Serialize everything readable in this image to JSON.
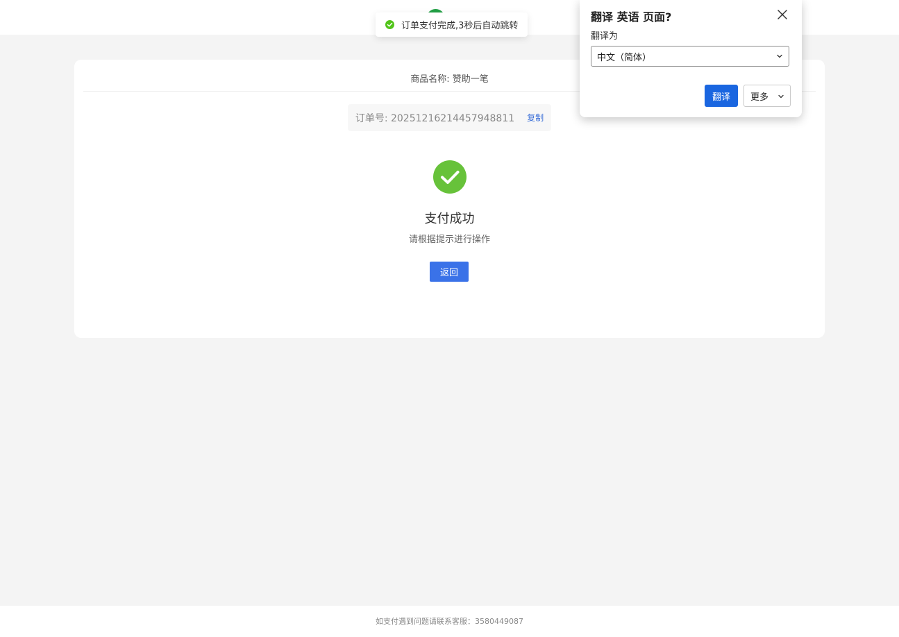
{
  "toast": {
    "message": "订单支付完成,3秒后自动跳转",
    "icon": "check-circle-icon",
    "color": "#52c41a"
  },
  "card": {
    "product_name": "商品名称: 赞助一笔",
    "order_label": "订单号: 20251216214457948811",
    "copy_label": "复制",
    "success_icon": "check-circle-icon",
    "success_color": "#67c23a",
    "success_title": "支付成功",
    "success_subtitle": "请根据提示进行操作",
    "back_label": "返回"
  },
  "footer": {
    "text": "如支付遇到问题请联系客服：3580449087"
  },
  "translate_popup": {
    "title": "翻译 英语 页面?",
    "target_label": "翻译为",
    "selected_language": "中文（简体）",
    "translate_button": "翻译",
    "more_button": "更多",
    "accent": "#1a66e0"
  }
}
